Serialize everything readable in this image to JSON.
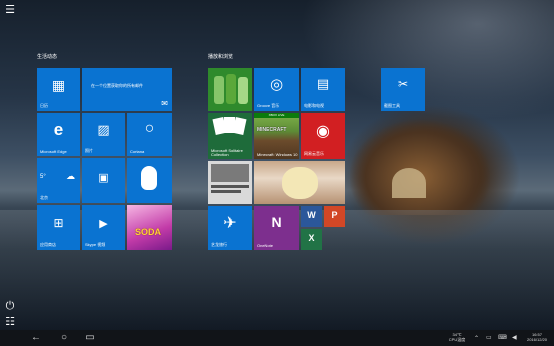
{
  "groups": {
    "left_label": "生活动态",
    "right_label": "播放和浏览"
  },
  "tiles": {
    "calendar_label": "日历",
    "calendar_text": "在一个位置获取你的所有邮件",
    "edge_label": "Microsoft Edge",
    "photos_label": "照片",
    "cortana_label": "Cortana",
    "weather_label": "北京",
    "weather_temp": "5°",
    "store_label": "应用商店",
    "skype_label": "Skype 视频",
    "candy_text": "SODA",
    "xbox_label": "",
    "groove_label": "Groove 音乐",
    "films_label": "电影和电视",
    "solitaire_label": "Microsoft Solitaire Collection",
    "minecraft_label": "Minecraft: Windows 10",
    "minecraft_badge": "XBOX LIVE",
    "netease_label": "网易云音乐",
    "news_label": "",
    "xuefu_label": "",
    "ie_label": "艺龙旅行",
    "onenote_label": "OneNote",
    "word_glyph": "W",
    "powerpoint_glyph": "P",
    "excel_glyph": "X",
    "download_label": "截图工具"
  },
  "taskbar": {
    "temp": "34℃",
    "cpu": "CPU温度",
    "time": "16:57",
    "date": "2016/12/20"
  },
  "icons": {
    "hamburger": "☰",
    "power": "⏻",
    "list": "☷",
    "back": "←",
    "circle": "○",
    "taskview": "▭"
  }
}
